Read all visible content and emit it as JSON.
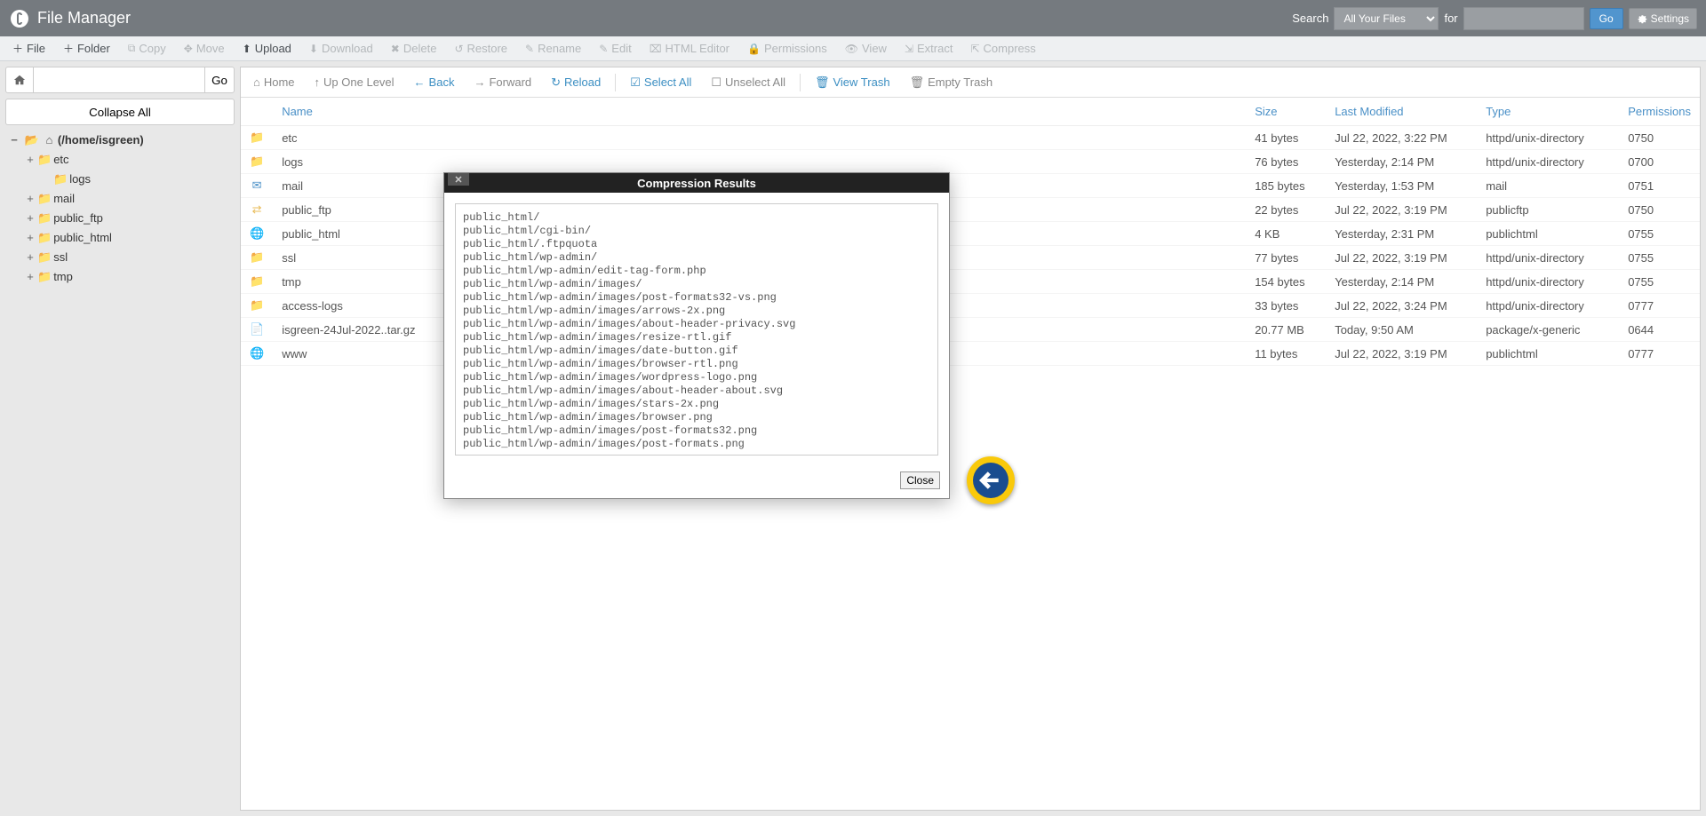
{
  "header": {
    "title": "File Manager",
    "search_label": "Search",
    "search_scope": "All Your Files",
    "for_label": "for",
    "go": "Go",
    "settings": "Settings"
  },
  "toolbar": {
    "file": "File",
    "folder": "Folder",
    "copy": "Copy",
    "move": "Move",
    "upload": "Upload",
    "download": "Download",
    "delete": "Delete",
    "restore": "Restore",
    "rename": "Rename",
    "edit": "Edit",
    "html_editor": "HTML Editor",
    "permissions": "Permissions",
    "view": "View",
    "extract": "Extract",
    "compress": "Compress"
  },
  "sidebar": {
    "go": "Go",
    "collapse_all": "Collapse All",
    "root": "(/home/isgreen)",
    "nodes": [
      "etc",
      "logs",
      "mail",
      "public_ftp",
      "public_html",
      "ssl",
      "tmp"
    ]
  },
  "actions": {
    "home": "Home",
    "up": "Up One Level",
    "back": "Back",
    "forward": "Forward",
    "reload": "Reload",
    "select_all": "Select All",
    "unselect_all": "Unselect All",
    "view_trash": "View Trash",
    "empty_trash": "Empty Trash"
  },
  "columns": {
    "name": "Name",
    "size": "Size",
    "last_modified": "Last Modified",
    "type": "Type",
    "permissions": "Permissions"
  },
  "files": [
    {
      "icon": "folder",
      "name": "etc",
      "size": "41 bytes",
      "modified": "Jul 22, 2022, 3:22 PM",
      "type": "httpd/unix-directory",
      "perm": "0750"
    },
    {
      "icon": "folder",
      "name": "logs",
      "size": "76 bytes",
      "modified": "Yesterday, 2:14 PM",
      "type": "httpd/unix-directory",
      "perm": "0700"
    },
    {
      "icon": "mail",
      "name": "mail",
      "size": "185 bytes",
      "modified": "Yesterday, 1:53 PM",
      "type": "mail",
      "perm": "0751"
    },
    {
      "icon": "link",
      "name": "public_ftp",
      "size": "22 bytes",
      "modified": "Jul 22, 2022, 3:19 PM",
      "type": "publicftp",
      "perm": "0750"
    },
    {
      "icon": "globe",
      "name": "public_html",
      "size": "4 KB",
      "modified": "Yesterday, 2:31 PM",
      "type": "publichtml",
      "perm": "0755"
    },
    {
      "icon": "folder",
      "name": "ssl",
      "size": "77 bytes",
      "modified": "Jul 22, 2022, 3:19 PM",
      "type": "httpd/unix-directory",
      "perm": "0755"
    },
    {
      "icon": "folder",
      "name": "tmp",
      "size": "154 bytes",
      "modified": "Yesterday, 2:14 PM",
      "type": "httpd/unix-directory",
      "perm": "0755"
    },
    {
      "icon": "linkfolder",
      "name": "access-logs",
      "size": "33 bytes",
      "modified": "Jul 22, 2022, 3:24 PM",
      "type": "httpd/unix-directory",
      "perm": "0777"
    },
    {
      "icon": "file",
      "name": "isgreen-24Jul-2022..tar.gz",
      "size": "20.77 MB",
      "modified": "Today, 9:50 AM",
      "type": "package/x-generic",
      "perm": "0644"
    },
    {
      "icon": "globelink",
      "name": "www",
      "size": "11 bytes",
      "modified": "Jul 22, 2022, 3:19 PM",
      "type": "publichtml",
      "perm": "0777"
    }
  ],
  "modal": {
    "title": "Compression Results",
    "close": "Close",
    "output": "public_html/\npublic_html/cgi-bin/\npublic_html/.ftpquota\npublic_html/wp-admin/\npublic_html/wp-admin/edit-tag-form.php\npublic_html/wp-admin/images/\npublic_html/wp-admin/images/post-formats32-vs.png\npublic_html/wp-admin/images/arrows-2x.png\npublic_html/wp-admin/images/about-header-privacy.svg\npublic_html/wp-admin/images/resize-rtl.gif\npublic_html/wp-admin/images/date-button.gif\npublic_html/wp-admin/images/browser-rtl.png\npublic_html/wp-admin/images/wordpress-logo.png\npublic_html/wp-admin/images/about-header-about.svg\npublic_html/wp-admin/images/stars-2x.png\npublic_html/wp-admin/images/browser.png\npublic_html/wp-admin/images/post-formats32.png\npublic_html/wp-admin/images/post-formats.png"
  }
}
